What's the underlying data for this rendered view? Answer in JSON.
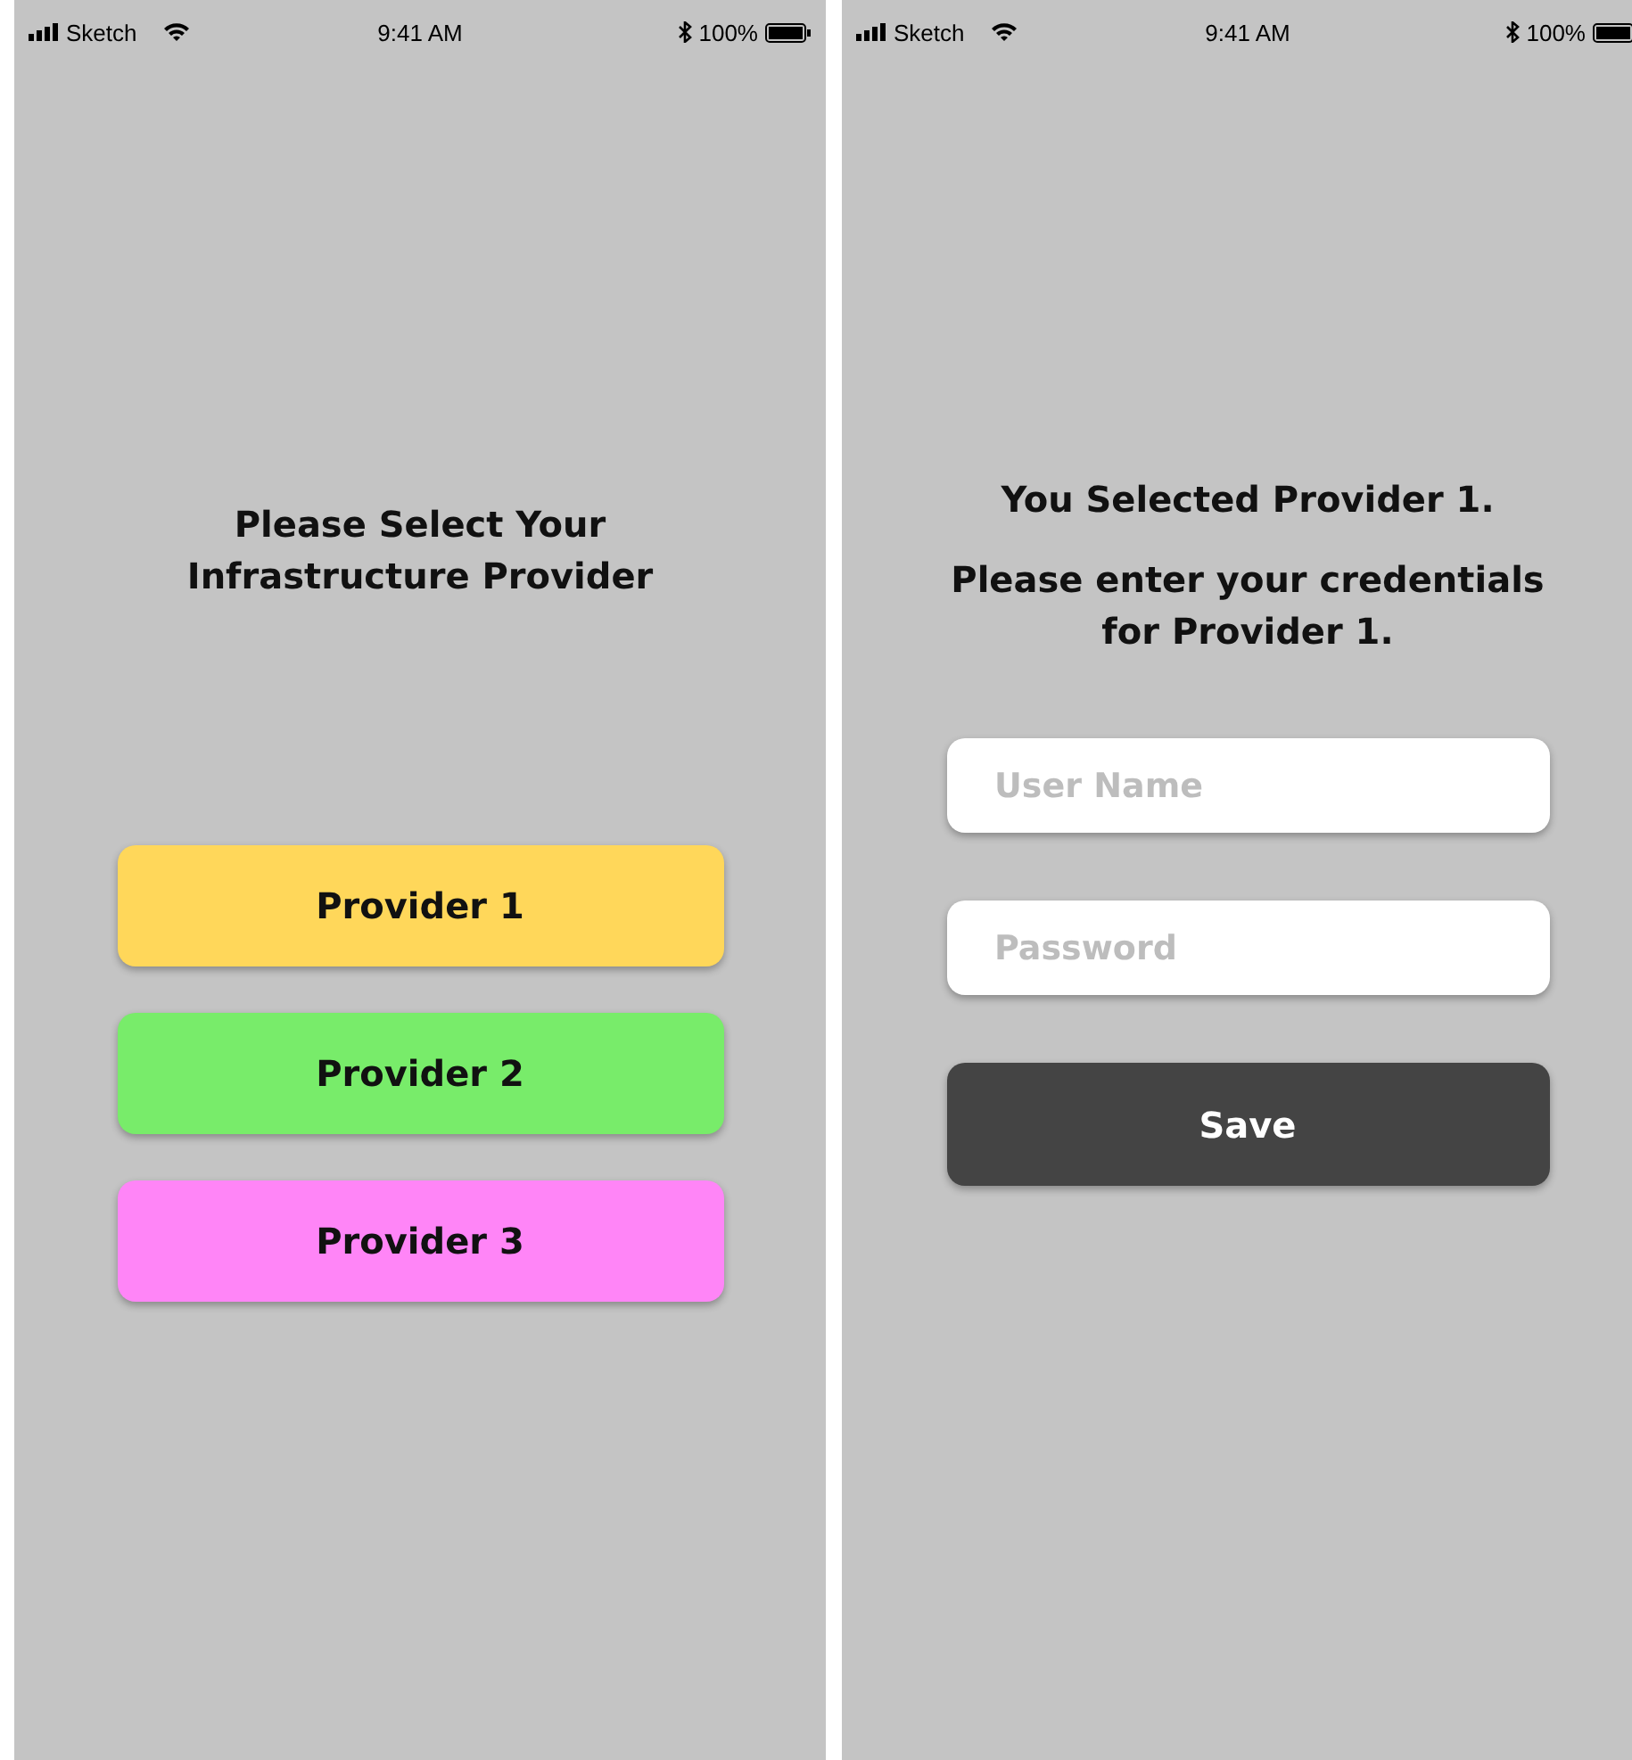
{
  "screens": [
    {
      "status_bar": {
        "carrier": "Sketch",
        "time": "9:41 AM",
        "battery": "100%"
      },
      "heading": "Please Select Your Infrastructure Provider",
      "providers": [
        {
          "label": "Provider 1",
          "color": "#ffd75a"
        },
        {
          "label": "Provider 2",
          "color": "#78ec6a"
        },
        {
          "label": "Provider 3",
          "color": "#ff85f7"
        }
      ]
    },
    {
      "status_bar": {
        "carrier": "Sketch",
        "time": "9:41 AM",
        "battery": "100%"
      },
      "title": "You Selected Provider 1.",
      "message": "Please enter your credentials for Provider 1.",
      "fields": [
        {
          "placeholder": "User Name"
        },
        {
          "placeholder": "Password"
        }
      ],
      "save_button": "Save"
    }
  ]
}
